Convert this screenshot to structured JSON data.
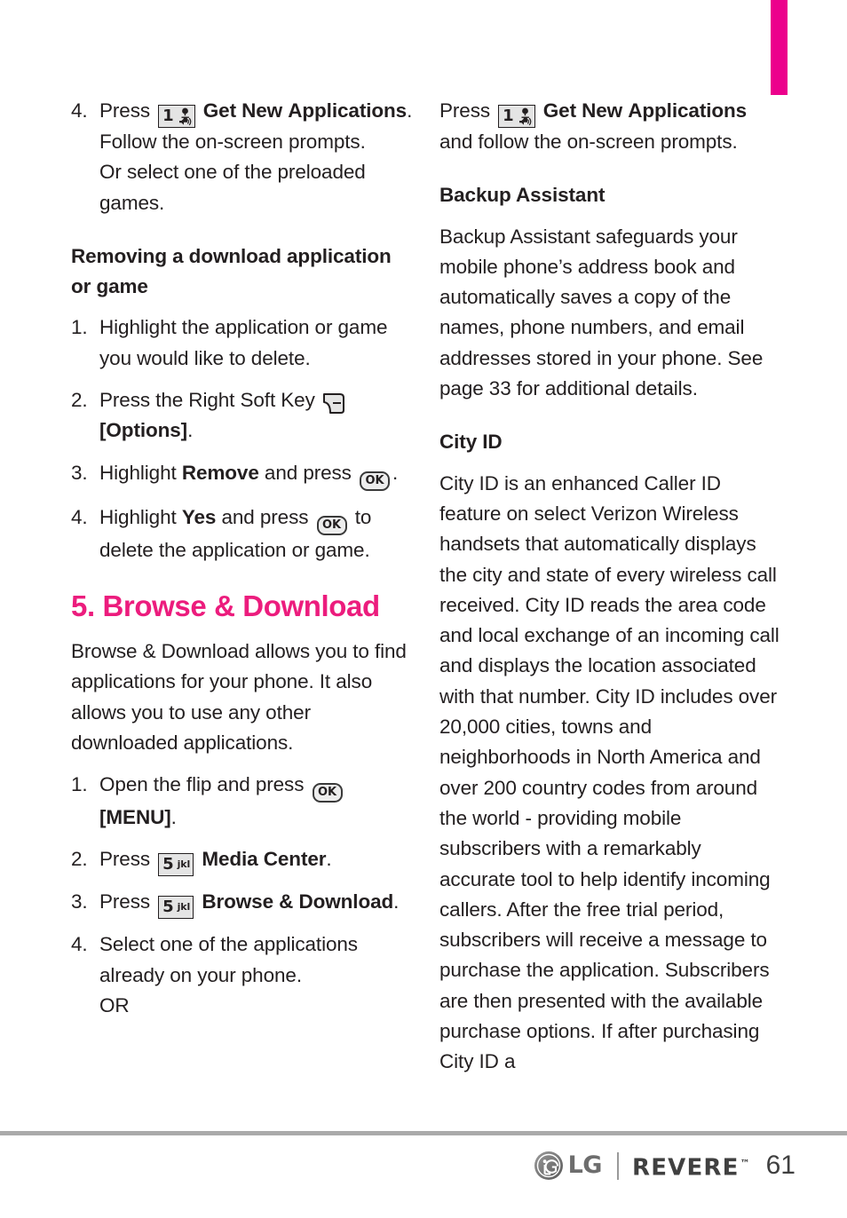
{
  "page": {
    "number": "61",
    "brand": "LG",
    "model": "REVERE",
    "trademark": "™"
  },
  "icons": {
    "key_one_digit": "1",
    "key_one_label": "voicemail-key",
    "key_five_digit": "5",
    "key_five_letters": "jkl",
    "ok_key_label": "OK",
    "soft_key_label": "right-soft-key"
  },
  "left_column": {
    "step4_games": {
      "num": "4.",
      "text_press": "Press",
      "bold_get_new": "Get New",
      "bold_applications": "Applications",
      "text_after": ". Follow the on-screen prompts.",
      "text_or": "Or select one of the preloaded games."
    },
    "heading_removing": "Removing a download application or game",
    "remove_steps": [
      {
        "num": "1.",
        "text": "Highlight the application or game you would like to delete."
      },
      {
        "num": "2.",
        "text_before": "Press the Right Soft Key",
        "bold_after": "[Options]",
        "text_end": "."
      },
      {
        "num": "3.",
        "text_before": "Highlight",
        "bold": "Remove",
        "text_mid": "and press",
        "text_end": "."
      },
      {
        "num": "4.",
        "text_before": "Highlight",
        "bold": "Yes",
        "text_mid": "and press",
        "text_end": "to delete the application or game."
      }
    ],
    "chapter_heading": "5. Browse & Download",
    "chapter_intro": "Browse & Download allows you to find applications for your phone. It also allows you to use any other downloaded applications.",
    "browse_steps": [
      {
        "num": "1.",
        "text_before": "Open the flip and press",
        "bold_after": "[MENU]",
        "text_end": "."
      },
      {
        "num": "2.",
        "text_before": "Press",
        "bold_after": "Media Center",
        "text_end": "."
      },
      {
        "num": "3.",
        "text_before": "Press",
        "bold_after": "Browse & Download",
        "text_end": "."
      },
      {
        "num": "4.",
        "text": "Select one of the applications already on your phone.",
        "text_or": "OR"
      }
    ]
  },
  "right_column": {
    "continued_step": {
      "text_press": "Press",
      "bold_get_new": "Get New",
      "bold_applications": "Applications",
      "text_after": " and follow the on-screen prompts."
    },
    "heading_backup": "Backup Assistant",
    "backup_body": "Backup Assistant safeguards your mobile phone’s address book and automatically saves a copy of the names, phone numbers, and email addresses stored in your phone. See page 33 for additional details.",
    "heading_cityid": "City ID",
    "cityid_body": "City ID is an enhanced Caller ID feature on select Verizon Wireless handsets that automatically displays the city and state of every wireless call received. City ID reads the area code and local exchange of an incoming call and displays the location associated with that number. City ID includes over 20,000 cities, towns and neighborhoods in North America and over 200 country codes from around the world - providing mobile subscribers with a remarkably accurate tool to help identify incoming callers. After the free trial period, subscribers will receive a message to purchase the application. Subscribers are then presented with the available purchase options.  If after purchasing City ID a"
  },
  "colors": {
    "chapter_tab": "#ec008c",
    "chapter_heading": "#ec1c7d",
    "text": "#231f20",
    "rule": "#aaaaaa"
  }
}
